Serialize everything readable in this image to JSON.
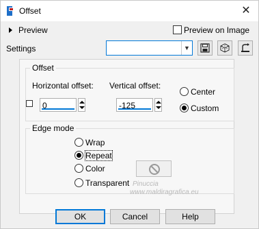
{
  "window": {
    "title": "Offset",
    "close_glyph": "✕"
  },
  "preview": {
    "label": "Preview"
  },
  "preview_on_image": {
    "label": "Preview on Image",
    "checked": false
  },
  "settings": {
    "label": "Settings",
    "value": ""
  },
  "offset_group": {
    "title": "Offset",
    "horizontal_label": "Horizontal offset:",
    "horizontal_value": "0",
    "vertical_label": "Vertical offset:",
    "vertical_value": "-125",
    "options": [
      {
        "label": "Center",
        "selected": false
      },
      {
        "label": "Custom",
        "selected": true
      }
    ]
  },
  "edge_group": {
    "title": "Edge mode",
    "options": [
      {
        "label": "Wrap",
        "selected": false
      },
      {
        "label": "Repeat",
        "selected": true
      },
      {
        "label": "Color",
        "selected": false
      },
      {
        "label": "Transparent",
        "selected": false
      }
    ]
  },
  "watermark": {
    "name": "Pinuccia",
    "url": "www.maldiragrafica.eu"
  },
  "buttons": {
    "ok": "OK",
    "cancel": "Cancel",
    "help": "Help"
  },
  "icons": [
    "app-icon",
    "save-icon",
    "randomize-icon",
    "reset-icon",
    "no-color-icon"
  ],
  "colors": {
    "accent": "#0078d7"
  }
}
